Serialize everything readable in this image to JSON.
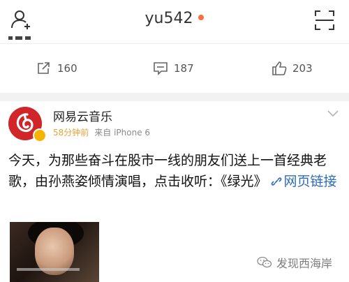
{
  "header": {
    "username": "yu542",
    "add_user_icon": "add-user-icon",
    "scan_icon": "scan-icon",
    "online_dot_color": "#ff6b3d"
  },
  "actions": {
    "repost": {
      "icon": "repost-icon",
      "count": "160"
    },
    "comment": {
      "icon": "comment-icon",
      "count": "187"
    },
    "like": {
      "icon": "thumbs-up-icon",
      "count": "203"
    }
  },
  "post": {
    "author": "网易云音乐",
    "time": "58分钟前",
    "source": "来自 iPhone 6",
    "text": "今天，为那些奋斗在股市一线的朋友们送上一首经典老歌，由孙燕姿倾情演唱，点击收听：《绿光》",
    "link_icon": "link-icon",
    "link_text": "网页链接",
    "verified_color": "#f6b400",
    "avatar_color": "#d0262a"
  },
  "watermark": {
    "text": "发现西海岸",
    "icon": "wechat-icon"
  }
}
